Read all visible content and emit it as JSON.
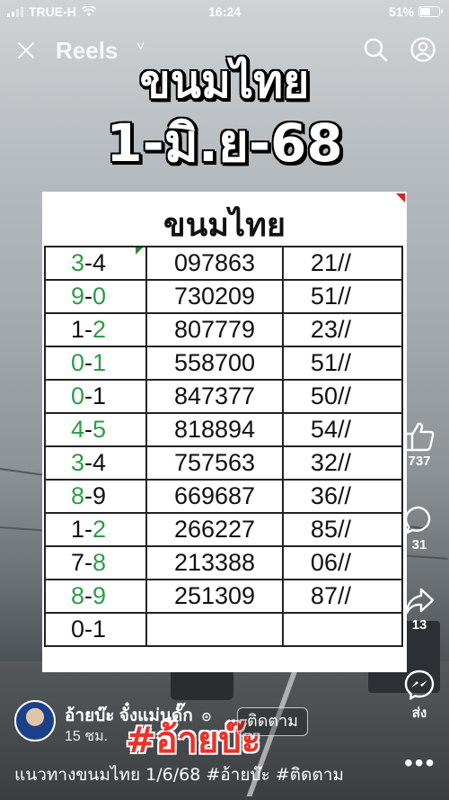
{
  "status_bar": {
    "carrier": "TRUE-H",
    "time": "16:24",
    "battery": "51%"
  },
  "topbar": {
    "title": "Reels",
    "title_chevron": "˅",
    "icons": [
      "close-icon",
      "search-icon",
      "profile-icon"
    ]
  },
  "headline": {
    "line1": "ขนมไทย",
    "line2": "1-มิ.ย-68"
  },
  "sheet": {
    "title": "ขนมไทย",
    "rows": [
      {
        "pair_a": "3",
        "sep": "-",
        "pair_b": "4",
        "a_green": true,
        "b_green": false,
        "number": "097863",
        "code": "21//"
      },
      {
        "pair_a": "9",
        "sep": "-",
        "pair_b": "0",
        "a_green": true,
        "b_green": true,
        "number": "730209",
        "code": "51//"
      },
      {
        "pair_a": "1",
        "sep": "-",
        "pair_b": "2",
        "a_green": false,
        "b_green": true,
        "number": "807779",
        "code": "23//"
      },
      {
        "pair_a": "0",
        "sep": "-",
        "pair_b": "1",
        "a_green": true,
        "b_green": true,
        "number": "558700",
        "code": "51//"
      },
      {
        "pair_a": "0",
        "sep": "-",
        "pair_b": "1",
        "a_green": true,
        "b_green": false,
        "number": "847377",
        "code": "50//"
      },
      {
        "pair_a": "4",
        "sep": "-",
        "pair_b": "5",
        "a_green": true,
        "b_green": true,
        "number": "818894",
        "code": "54//"
      },
      {
        "pair_a": "3",
        "sep": "-",
        "pair_b": "4",
        "a_green": true,
        "b_green": false,
        "number": "757563",
        "code": "32//"
      },
      {
        "pair_a": "8",
        "sep": "-",
        "pair_b": "9",
        "a_green": true,
        "b_green": false,
        "number": "669687",
        "code": "36//"
      },
      {
        "pair_a": "1",
        "sep": "-",
        "pair_b": "2",
        "a_green": false,
        "b_green": true,
        "number": "266227",
        "code": "85//"
      },
      {
        "pair_a": "7",
        "sep": "-",
        "pair_b": "8",
        "a_green": false,
        "b_green": true,
        "number": "213388",
        "code": "06//"
      },
      {
        "pair_a": "8",
        "sep": "-",
        "pair_b": "9",
        "a_green": true,
        "b_green": true,
        "number": "251309",
        "code": "87//"
      },
      {
        "pair_a": "0",
        "sep": "-",
        "pair_b": "1",
        "a_green": false,
        "b_green": false,
        "number": "",
        "code": ""
      }
    ]
  },
  "actions": {
    "like_count": "737",
    "comment_count": "31",
    "share_count": "13",
    "send_label": "ส่ง"
  },
  "author": {
    "name": "อ้ายบ๊ะ จั๋งแม่นดั๊ก",
    "verified_mark": "⊙",
    "time_ago": "15 ชม.",
    "follow_label": "ติดตาม"
  },
  "overlay_hashtag": "#อ้ายบ๊ะ",
  "caption": "แนวทางขนมไทย 1/6/68 #อ้ายบ๊ะ #ติดตาม",
  "more_label": "•••",
  "colors": {
    "green_digit": "#2e9c48",
    "hashtag_red": "#e8332b"
  }
}
